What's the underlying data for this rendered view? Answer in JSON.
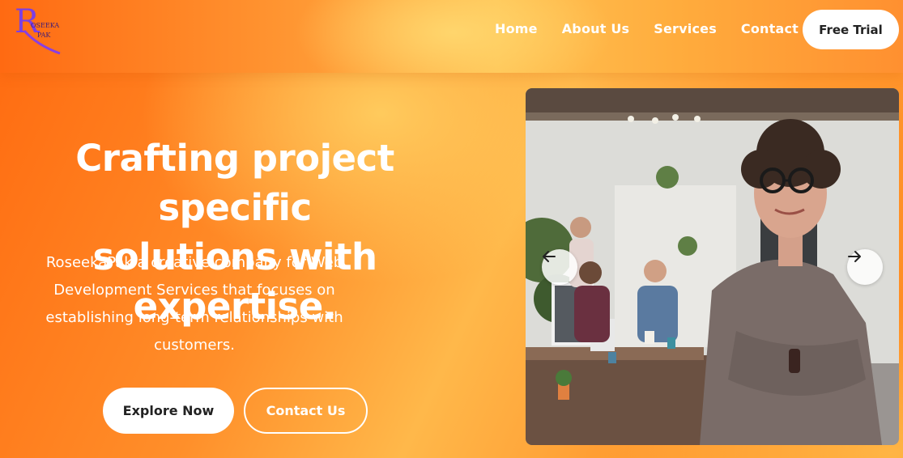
{
  "logo": {
    "alt": "RoseekaPak logo",
    "letter": "R",
    "line1": "OSEEKA",
    "line2": "PAK",
    "color": "#8a3fe0"
  },
  "nav": {
    "items": [
      {
        "label": "Home"
      },
      {
        "label": "About Us"
      },
      {
        "label": "Services"
      },
      {
        "label": "Contact"
      }
    ],
    "cta_label": "Free Trial"
  },
  "hero": {
    "title_line1": "Crafting project specific",
    "title_line2": "solutions with expertise.",
    "description": "RoseekaPak a creative company for Web Development Services that focuses on establishing long-term relationships with customers.",
    "primary_button": "Explore Now",
    "secondary_button": "Contact Us"
  },
  "carousel": {
    "image_alt": "Confident woman with crossed arms in an office with colleagues working in the background",
    "prev_icon": "arrow-left-icon",
    "next_icon": "arrow-right-icon"
  },
  "colors": {
    "accent_orange": "#ff7a18",
    "accent_yellow": "#ffc253",
    "button_bg": "#ffffff",
    "button_text": "#222222"
  }
}
